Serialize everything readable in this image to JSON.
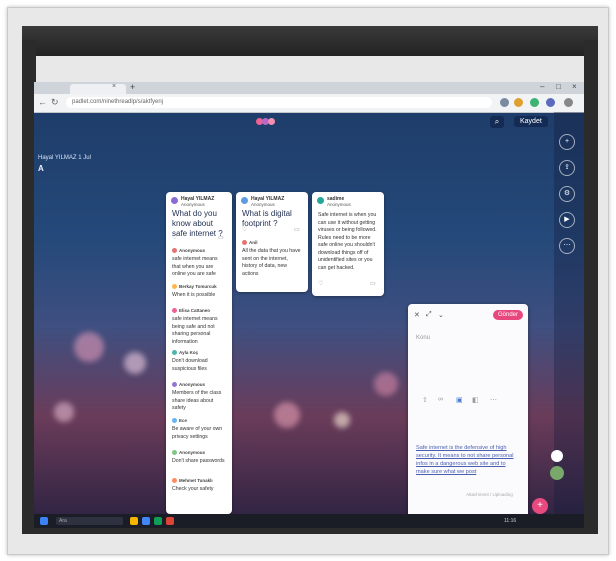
{
  "browser": {
    "url": "padlet.com/ninethreadlp/s/aktfyenj",
    "new_tab": "+",
    "tab_close": "×",
    "window_controls": [
      "–",
      "□",
      "×"
    ]
  },
  "app": {
    "save_label": "Kaydet",
    "board_title": "Hayal YILMAZ 1 Jul",
    "board_sub": "A"
  },
  "cards": [
    {
      "author": "Hayal YILMAZ",
      "sub": "Anonymous",
      "title": "What do you know about safe internet ?",
      "comments": [
        {
          "name": "Anonymous",
          "text": "safe internet means that when you are online you are safe"
        },
        {
          "name": "Berkay Tomurcuk",
          "text": "When it is possible"
        },
        {
          "name": "Elisa Cattaneo",
          "text": "safe internet means being safe and not sharing personal information"
        },
        {
          "name": "Ayla Koç",
          "text": "Don't download suspicious files"
        },
        {
          "name": "Anonymous",
          "text": "Members of the class share ideas about safety"
        },
        {
          "name": "Ece",
          "text": "Be aware of your own privacy settings"
        },
        {
          "name": "Anonymous",
          "text": "Don't share passwords"
        },
        {
          "name": "Mehmet Tunaklı",
          "text": "Check your safety"
        }
      ]
    },
    {
      "author": "Hayal YILMAZ",
      "sub": "Anonymous",
      "title": "What is digital footprint ?",
      "comments": [
        {
          "name": "Anil",
          "text": "All the data that you have sent on the internet, history of data, new actions"
        }
      ]
    },
    {
      "author": "sadime",
      "sub": "Anonymous",
      "body": "Safe internet is when you can use it without getting viruses or being followed. Rules need to be more safe online you shouldn't download things off of unidentified sites or you can get hacked."
    }
  ],
  "composer": {
    "send_label": "Gönder",
    "subject_placeholder": "Konu",
    "draft": "Safe internet is the defensive of high security. It means to not share personal infos in a dangerous web site and to make sure what we post",
    "footer": "Attachment / Uploading"
  },
  "taskbar": {
    "search_placeholder": "Ara",
    "tray_time": "11:16"
  }
}
